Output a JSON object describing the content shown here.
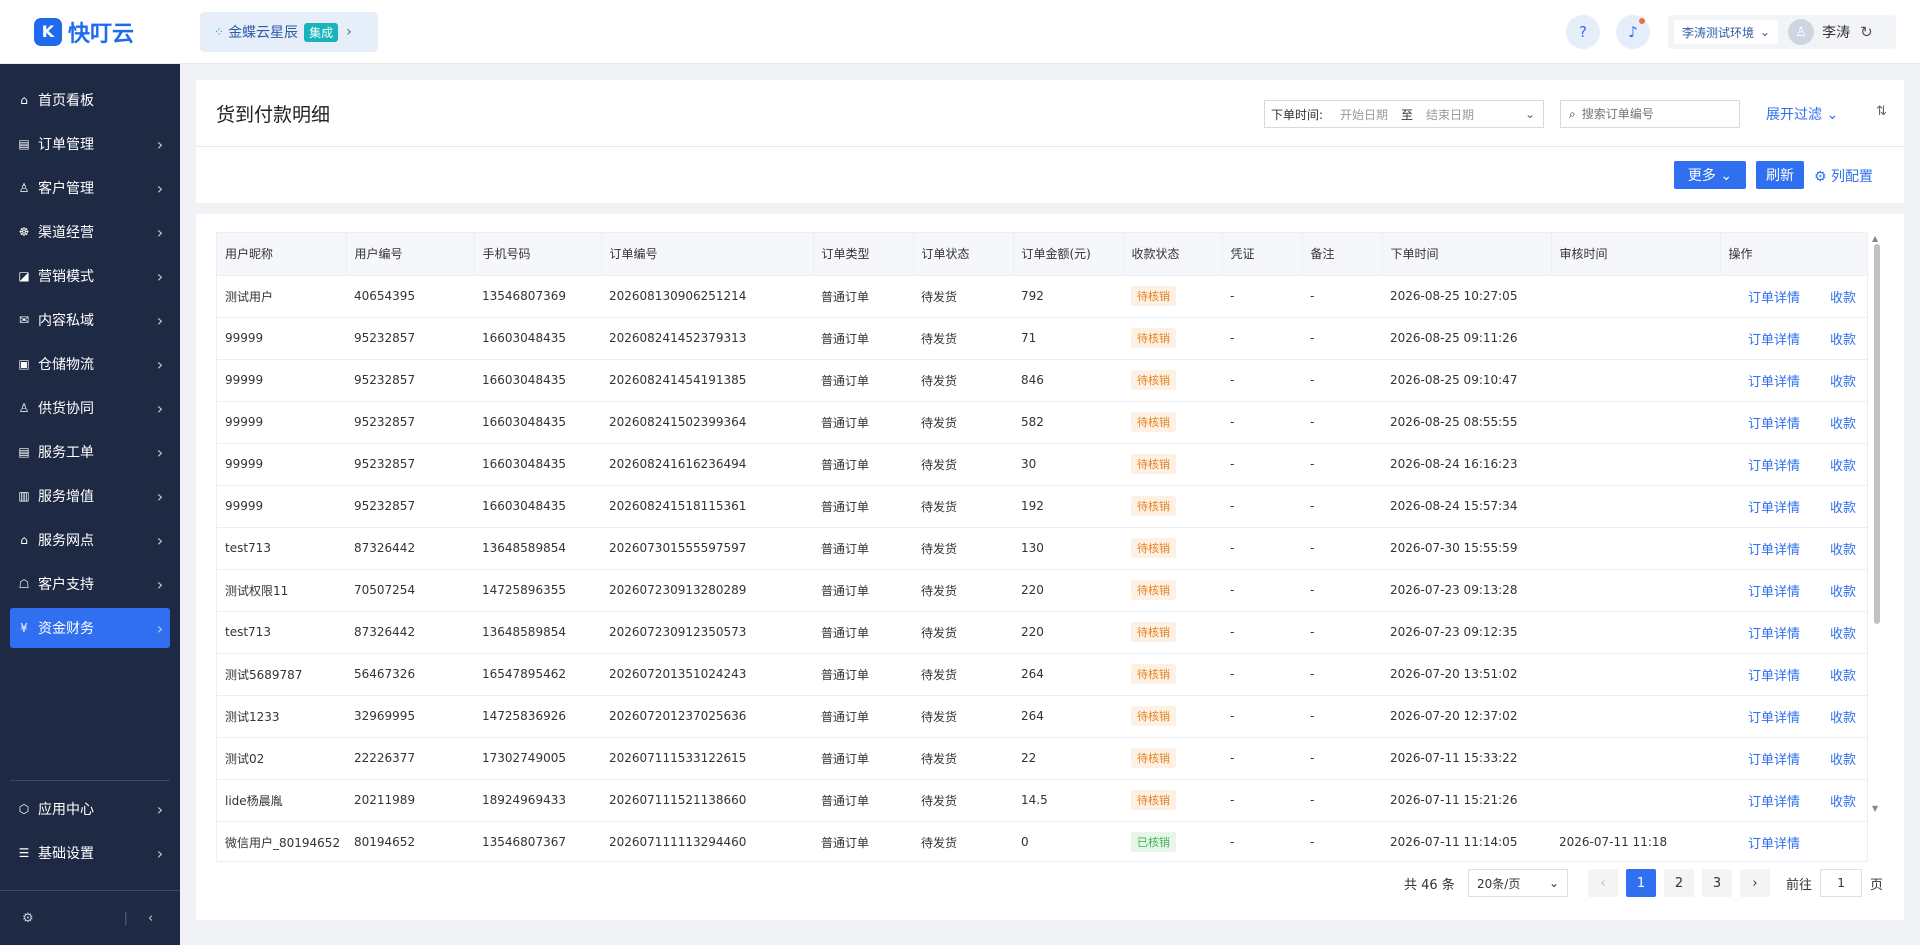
{
  "app": {
    "logo_mark": "K",
    "logo_text": "快叮云"
  },
  "sidebar": {
    "items": [
      {
        "label": "首页看板",
        "icon": "⌂",
        "arrow": ""
      },
      {
        "label": "订单管理",
        "icon": "▤",
        "arrow": "›"
      },
      {
        "label": "客户管理",
        "icon": "♙",
        "arrow": "›"
      },
      {
        "label": "渠道经营",
        "icon": "☸",
        "arrow": "›"
      },
      {
        "label": "营销模式",
        "icon": "◪",
        "arrow": "›"
      },
      {
        "label": "内容私域",
        "icon": "✉",
        "arrow": "›"
      },
      {
        "label": "仓储物流",
        "icon": "▣",
        "arrow": "›"
      },
      {
        "label": "供货协同",
        "icon": "♙",
        "arrow": "›"
      },
      {
        "label": "服务工单",
        "icon": "▤",
        "arrow": "›"
      },
      {
        "label": "服务增值",
        "icon": "▥",
        "arrow": "›"
      },
      {
        "label": "服务网点",
        "icon": "⌂",
        "arrow": "›"
      },
      {
        "label": "客户支持",
        "icon": "☖",
        "arrow": "›"
      },
      {
        "label": "资金财务",
        "icon": "¥",
        "arrow": "›"
      }
    ],
    "bottom_items": [
      {
        "label": "应用中心",
        "icon": "⬡",
        "arrow": "›"
      },
      {
        "label": "基础设置",
        "icon": "☰",
        "arrow": "›"
      }
    ],
    "footer": {
      "settings_icon": "⚙",
      "sep": "|",
      "collapse_icon": "‹"
    }
  },
  "topbar": {
    "org_name": "金蝶云星辰",
    "org_badge": "集成",
    "org_arrow": "›",
    "help_icon": "?",
    "bell_icon": "♪",
    "env_label": "李涛测试环境",
    "env_arrow": "⌄",
    "avatar_icon": "♙",
    "user_name": "李涛",
    "refresh_icon": "↻"
  },
  "header": {
    "title": "货到付款明细",
    "date_label": "下单时间:",
    "start_placeholder": "开始日期",
    "date_sep": "至",
    "end_placeholder": "结束日期",
    "date_arrow": "⌄",
    "search_icon": "⌕",
    "search_placeholder": "搜索订单编号",
    "expand_filter": "展开过滤 ⌄",
    "sort_icon": "⇅",
    "more_button": "更多 ⌄",
    "refresh_button": "刷新",
    "column_config": "⚙ 列配置"
  },
  "table": {
    "columns": [
      "用户昵称",
      "用户编号",
      "手机号码",
      "订单编号",
      "订单类型",
      "订单状态",
      "订单金额(元)",
      "收款状态",
      "凭证",
      "备注",
      "下单时间",
      "审核时间",
      "操作"
    ],
    "rows": [
      {
        "nick": "测试用户",
        "uid": "40654395",
        "phone": "13546807369",
        "order_no": "202608130906251214",
        "type": "普通订单",
        "status": "待发货",
        "amount": "792",
        "pay_status": "待核销",
        "voucher": "-",
        "remark": "-",
        "order_time": "2026-08-25 10:27:05",
        "audit_time": "",
        "op1": "订单详情",
        "op2": "收款"
      },
      {
        "nick": "99999",
        "uid": "95232857",
        "phone": "16603048435",
        "order_no": "202608241452379313",
        "type": "普通订单",
        "status": "待发货",
        "amount": "71",
        "pay_status": "待核销",
        "voucher": "-",
        "remark": "-",
        "order_time": "2026-08-25 09:11:26",
        "audit_time": "",
        "op1": "订单详情",
        "op2": "收款"
      },
      {
        "nick": "99999",
        "uid": "95232857",
        "phone": "16603048435",
        "order_no": "202608241454191385",
        "type": "普通订单",
        "status": "待发货",
        "amount": "846",
        "pay_status": "待核销",
        "voucher": "-",
        "remark": "-",
        "order_time": "2026-08-25 09:10:47",
        "audit_time": "",
        "op1": "订单详情",
        "op2": "收款"
      },
      {
        "nick": "99999",
        "uid": "95232857",
        "phone": "16603048435",
        "order_no": "202608241502399364",
        "type": "普通订单",
        "status": "待发货",
        "amount": "582",
        "pay_status": "待核销",
        "voucher": "-",
        "remark": "-",
        "order_time": "2026-08-25 08:55:55",
        "audit_time": "",
        "op1": "订单详情",
        "op2": "收款"
      },
      {
        "nick": "99999",
        "uid": "95232857",
        "phone": "16603048435",
        "order_no": "202608241616236494",
        "type": "普通订单",
        "status": "待发货",
        "amount": "30",
        "pay_status": "待核销",
        "voucher": "-",
        "remark": "-",
        "order_time": "2026-08-24 16:16:23",
        "audit_time": "",
        "op1": "订单详情",
        "op2": "收款"
      },
      {
        "nick": "99999",
        "uid": "95232857",
        "phone": "16603048435",
        "order_no": "202608241518115361",
        "type": "普通订单",
        "status": "待发货",
        "amount": "192",
        "pay_status": "待核销",
        "voucher": "-",
        "remark": "-",
        "order_time": "2026-08-24 15:57:34",
        "audit_time": "",
        "op1": "订单详情",
        "op2": "收款"
      },
      {
        "nick": "test713",
        "uid": "87326442",
        "phone": "13648589854",
        "order_no": "202607301555597597",
        "type": "普通订单",
        "status": "待发货",
        "amount": "130",
        "pay_status": "待核销",
        "voucher": "-",
        "remark": "-",
        "order_time": "2026-07-30 15:55:59",
        "audit_time": "",
        "op1": "订单详情",
        "op2": "收款"
      },
      {
        "nick": "测试权限11",
        "uid": "70507254",
        "phone": "14725896355",
        "order_no": "202607230913280289",
        "type": "普通订单",
        "status": "待发货",
        "amount": "220",
        "pay_status": "待核销",
        "voucher": "-",
        "remark": "-",
        "order_time": "2026-07-23 09:13:28",
        "audit_time": "",
        "op1": "订单详情",
        "op2": "收款"
      },
      {
        "nick": "test713",
        "uid": "87326442",
        "phone": "13648589854",
        "order_no": "202607230912350573",
        "type": "普通订单",
        "status": "待发货",
        "amount": "220",
        "pay_status": "待核销",
        "voucher": "-",
        "remark": "-",
        "order_time": "2026-07-23 09:12:35",
        "audit_time": "",
        "op1": "订单详情",
        "op2": "收款"
      },
      {
        "nick": "测试5689787",
        "uid": "56467326",
        "phone": "16547895462",
        "order_no": "202607201351024243",
        "type": "普通订单",
        "status": "待发货",
        "amount": "264",
        "pay_status": "待核销",
        "voucher": "-",
        "remark": "-",
        "order_time": "2026-07-20 13:51:02",
        "audit_time": "",
        "op1": "订单详情",
        "op2": "收款"
      },
      {
        "nick": "测试1233",
        "uid": "32969995",
        "phone": "14725836926",
        "order_no": "202607201237025636",
        "type": "普通订单",
        "status": "待发货",
        "amount": "264",
        "pay_status": "待核销",
        "voucher": "-",
        "remark": "-",
        "order_time": "2026-07-20 12:37:02",
        "audit_time": "",
        "op1": "订单详情",
        "op2": "收款"
      },
      {
        "nick": "测试02",
        "uid": "22226377",
        "phone": "17302749005",
        "order_no": "202607111533122615",
        "type": "普通订单",
        "status": "待发货",
        "amount": "22",
        "pay_status": "待核销",
        "voucher": "-",
        "remark": "-",
        "order_time": "2026-07-11 15:33:22",
        "audit_time": "",
        "op1": "订单详情",
        "op2": "收款"
      },
      {
        "nick": "lide杨晨胤",
        "uid": "20211989",
        "phone": "18924969433",
        "order_no": "202607111521138660",
        "type": "普通订单",
        "status": "待发货",
        "amount": "14.5",
        "pay_status": "待核销",
        "voucher": "-",
        "remark": "-",
        "order_time": "2026-07-11 15:21:26",
        "audit_time": "",
        "op1": "订单详情",
        "op2": "收款"
      },
      {
        "nick": "微信用户_80194652",
        "uid": "80194652",
        "phone": "13546807367",
        "order_no": "202607111113294460",
        "type": "普通订单",
        "status": "待发货",
        "amount": "0",
        "pay_status": "已核销",
        "voucher": "-",
        "remark": "-",
        "order_time": "2026-07-11 11:14:05",
        "audit_time": "2026-07-11 11:18",
        "op1": "订单详情",
        "op2": ""
      }
    ]
  },
  "pagination": {
    "total": "共 46 条",
    "page_size": "20条/页",
    "size_arrow": "⌄",
    "prev": "‹",
    "pages": [
      "1",
      "2",
      "3"
    ],
    "next": "›",
    "jump_label": "前往",
    "jump_value": "1",
    "jump_unit": "页"
  },
  "colors": {
    "accent": "#2f6ff0",
    "sidebar_bg": "#1e2a44",
    "pending": "#e6811b",
    "done": "#3cb44b"
  }
}
